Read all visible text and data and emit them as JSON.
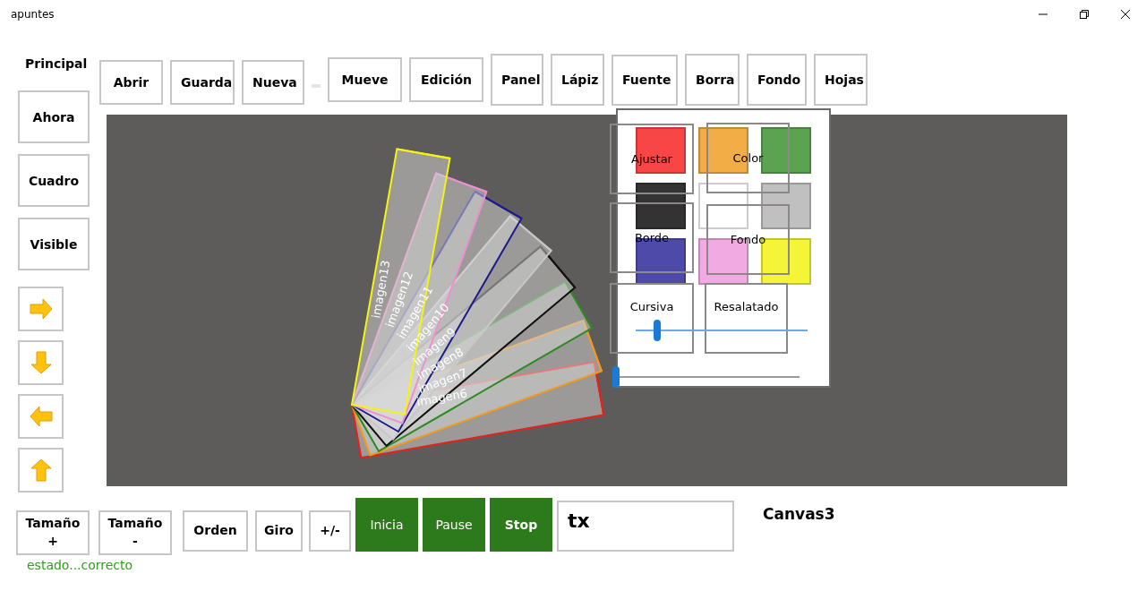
{
  "window": {
    "title": "apuntes"
  },
  "section_label": "Principal",
  "toolbar": [
    {
      "label": "Abrir"
    },
    {
      "label": "Guarda"
    },
    {
      "label": "Nueva"
    },
    {
      "label": "Mueve"
    },
    {
      "label": "Edición"
    },
    {
      "label": "Panel"
    },
    {
      "label": "Lápiz"
    },
    {
      "label": "Fuente"
    },
    {
      "label": "Borra"
    },
    {
      "label": "Fondo"
    },
    {
      "label": "Hojas"
    }
  ],
  "side_buttons": [
    {
      "label": "Ahora"
    },
    {
      "label": "Cuadro"
    },
    {
      "label": "Visible"
    }
  ],
  "arrow_buttons": [
    {
      "kind": "right"
    },
    {
      "kind": "down"
    },
    {
      "kind": "left"
    },
    {
      "kind": "up"
    }
  ],
  "canvas": {
    "frames": [
      {
        "label": "imagen6",
        "color": "#e8201c"
      },
      {
        "label": "imagen7",
        "color": "#f29a1f"
      },
      {
        "label": "imagen8",
        "color": "#2e8a22"
      },
      {
        "label": "imagen9",
        "color": "#111111"
      },
      {
        "label": "imagen10",
        "color": "#c8c8c8"
      },
      {
        "label": "imagen11",
        "color": "#1d1a8c"
      },
      {
        "label": "imagen12",
        "color": "#ee8fcf"
      },
      {
        "label": "imagen13",
        "color": "#f4f50f"
      }
    ]
  },
  "panel": {
    "swatches": [
      {
        "color": "#f84646"
      },
      {
        "color": "#f2ad46"
      },
      {
        "color": "#5ba350"
      },
      {
        "color": "#333333"
      },
      {
        "color": "#ffffff"
      },
      {
        "color": "#c0c0c0"
      },
      {
        "color": "#4e4aa9"
      },
      {
        "color": "#f2aae3"
      },
      {
        "color": "#f4f536"
      }
    ],
    "buttons": [
      {
        "label": "Ajustar"
      },
      {
        "label": "Color"
      },
      {
        "label": "Borde"
      },
      {
        "label": "Fondo"
      },
      {
        "label": "Cursiva"
      },
      {
        "label": "Resalatado"
      }
    ],
    "sliders": [
      {
        "level": 0.11
      },
      {
        "level": 0
      }
    ]
  },
  "bottom_buttons": [
    {
      "label": "Tamaño\n+",
      "kind": "plain"
    },
    {
      "label": "Tamaño\n-",
      "kind": "plain"
    },
    {
      "label": "Orden",
      "kind": "plain"
    },
    {
      "label": "Giro",
      "kind": "plain"
    },
    {
      "label": "+/-",
      "kind": "plain"
    },
    {
      "label": "Inicia",
      "kind": "green"
    },
    {
      "label": "Pause",
      "kind": "green"
    },
    {
      "label": "Stop",
      "kind": "green-bold"
    }
  ],
  "text_field": {
    "value": "tx"
  },
  "canvas_name": "Canvas3",
  "status": "estado...correcto"
}
